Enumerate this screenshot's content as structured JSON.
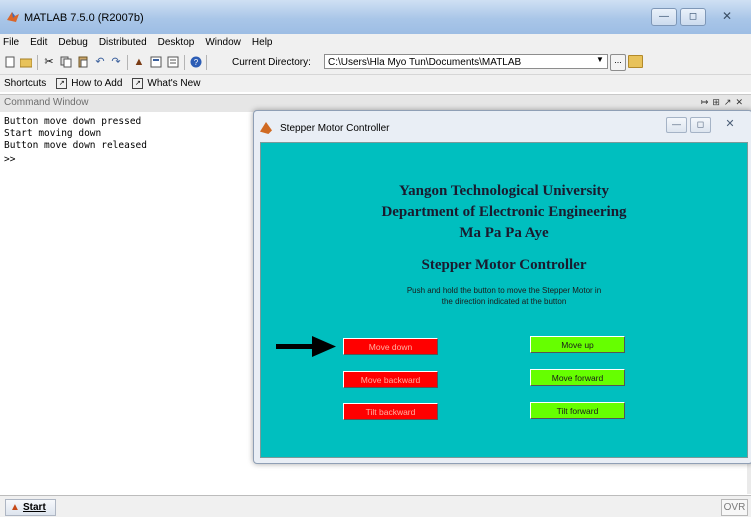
{
  "window": {
    "title": "MATLAB 7.5.0 (R2007b)"
  },
  "menubar": [
    "File",
    "Edit",
    "Debug",
    "Distributed",
    "Desktop",
    "Window",
    "Help"
  ],
  "toolbar": {
    "current_directory_label": "Current Directory:",
    "current_directory_value": "C:\\Users\\Hla Myo Tun\\Documents\\MATLAB",
    "browse_label": "...",
    "icons": [
      "new-file-icon",
      "open-folder-icon",
      "cut-icon",
      "copy-icon",
      "paste-icon",
      "undo-icon",
      "redo-icon",
      "simulink-icon",
      "guide-icon",
      "profiler-icon",
      "help-icon"
    ]
  },
  "shortcuts": {
    "label": "Shortcuts",
    "items": [
      "How to Add",
      "What's New"
    ]
  },
  "command_window": {
    "title": "Command Window",
    "lines": [
      "Button move down pressed",
      "Start moving down",
      "Button move down released",
      ">>"
    ]
  },
  "figure": {
    "title": "Stepper Motor Controller",
    "headings": [
      "Yangon Technological University",
      "Department of Electronic Engineering",
      "Ma Pa Pa Aye"
    ],
    "app_title": "Stepper Motor Controller",
    "instructions": [
      "Push and hold the button to move the Stepper Motor in",
      "the direction indicated at the button"
    ],
    "buttons_left": [
      "Move down",
      "Move backward",
      "Tilt backward"
    ],
    "buttons_right": [
      "Move up",
      "Move forward",
      "Tilt forward"
    ],
    "colors": {
      "background": "#00bfbf",
      "pressed": "#ff0000",
      "idle": "#66ff00"
    }
  },
  "statusbar": {
    "start_label": "Start",
    "ovr_label": "OVR"
  }
}
